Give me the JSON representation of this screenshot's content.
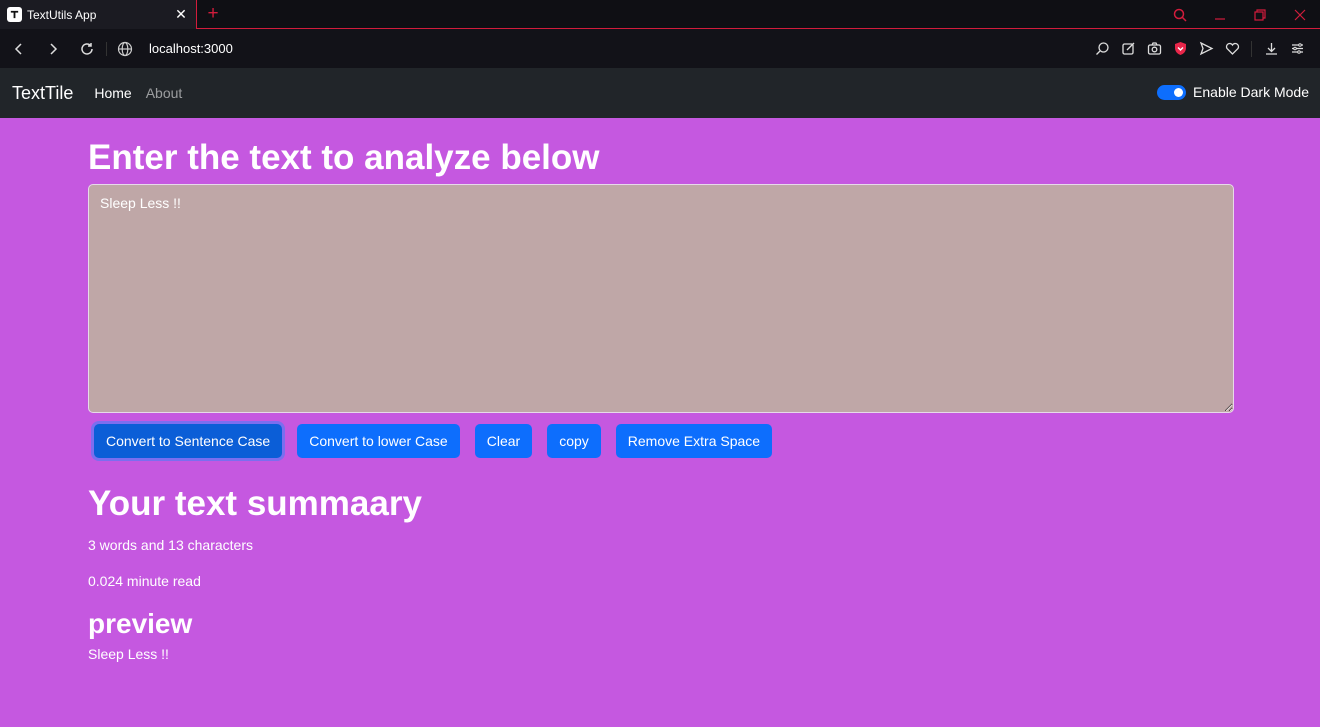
{
  "browser": {
    "tab_title": "TextUtils App",
    "url": "localhost:3000"
  },
  "navbar": {
    "brand": "TextTile",
    "links": [
      "Home",
      "About"
    ],
    "dark_mode_label": "Enable Dark Mode",
    "dark_mode_on": true
  },
  "main": {
    "heading": "Enter the text to analyze below",
    "textarea_value": "Sleep Less !!",
    "buttons": [
      "Convert to Sentence Case",
      "Convert to lower Case",
      "Clear",
      "copy",
      "Remove Extra Space"
    ],
    "summary_heading": "Your text summaary",
    "word_char_count": "3 words and 13 characters",
    "read_time": "0.024 minute read",
    "preview_heading": "preview",
    "preview_text": "Sleep Less !!"
  },
  "colors": {
    "page_background": "#c558e0",
    "navbar_background": "#212529",
    "button_primary": "#0d6efd",
    "textarea_background": "#bfa7a7",
    "browser_accent": "#d21c3c"
  }
}
